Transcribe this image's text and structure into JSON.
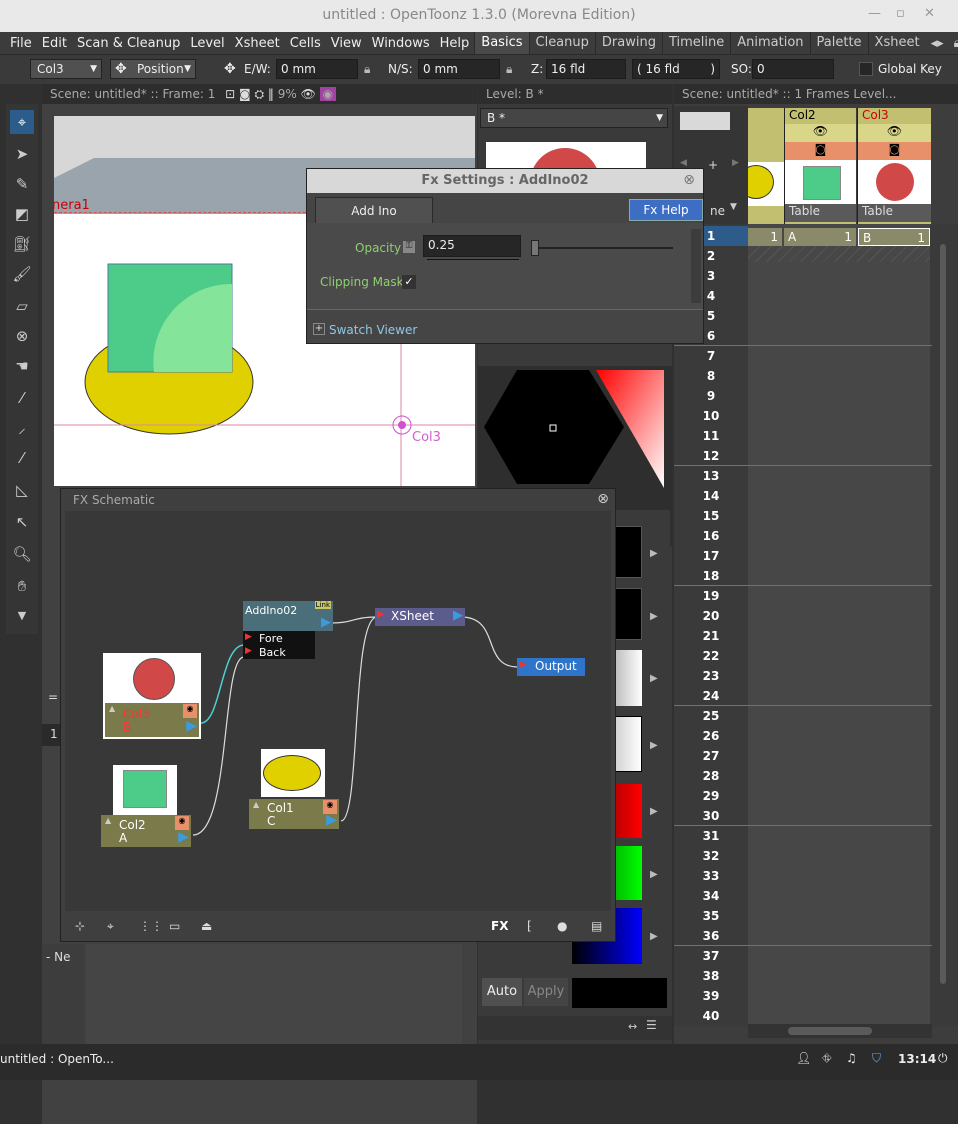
{
  "window": {
    "title": "untitled : OpenToonz 1.3.0 (Morevna Edition)",
    "min": "—",
    "max": "▫",
    "close": "✕"
  },
  "menu": [
    "File",
    "Edit",
    "Scan & Cleanup",
    "Level",
    "Xsheet",
    "Cells",
    "View",
    "Windows",
    "Help"
  ],
  "rooms": [
    "Basics",
    "Cleanup",
    "Drawing",
    "Timeline",
    "Animation",
    "Palette",
    "Xsheet"
  ],
  "tooloptions": {
    "object": "Col3",
    "mode": "Position",
    "ew_label": "E/W:",
    "ew_value": "0 mm",
    "ns_label": "N/S:",
    "ns_value": "0 mm",
    "z_label": "Z:",
    "z_value": "16 fld",
    "z_extra": "( 16 fld",
    "z_extra_close": ")",
    "so_label": "SO:",
    "so_value": "0",
    "global_key": "Global Key"
  },
  "viewer": {
    "header": "Scene: untitled*   ::   Frame: 1",
    "header_extra": "9%",
    "camera_label": "nera1",
    "col_label": "Col3"
  },
  "fxsettings": {
    "title": "Fx Settings : AddIno02",
    "tab": "Add Ino",
    "help": "Fx Help",
    "opacity_label": "Opacity",
    "opacity_value": "0.25",
    "clipping_label": "Clipping Mask",
    "swatch_viewer": "Swatch Viewer",
    "swatch_toggle": "+"
  },
  "level": {
    "header": "Level:  B *",
    "combo": "B *"
  },
  "schematic": {
    "title": "FX Schematic",
    "nodes": {
      "addino": {
        "name": "AddIno02",
        "link": "Link",
        "fore": "Fore",
        "back": "Back"
      },
      "xsheet": {
        "name": "XSheet"
      },
      "output": {
        "name": "Output"
      },
      "col3": {
        "name": "Col3",
        "level": "B"
      },
      "col2": {
        "name": "Col2",
        "level": "A"
      },
      "col1": {
        "name": "Col1",
        "level": "C"
      }
    },
    "footer_fx": "FX"
  },
  "xsheetpanel": {
    "header": "Scene: untitled*   ::   1 Frames  Level...",
    "columns": [
      {
        "name": "Col2",
        "pegbar": "Table",
        "cell": "A",
        "num": "1"
      },
      {
        "name": "Col3",
        "pegbar": "Table",
        "cell": "B",
        "num": "1"
      }
    ],
    "partial_pegbar": "ne",
    "first_num": "1",
    "rows": [
      "1",
      "2",
      "3",
      "4",
      "5",
      "6",
      "7",
      "8",
      "9",
      "10",
      "11",
      "12",
      "13",
      "14",
      "15",
      "16",
      "17",
      "18",
      "19",
      "20",
      "21",
      "22",
      "23",
      "24",
      "25",
      "26",
      "27",
      "28",
      "29",
      "30",
      "31",
      "32",
      "33",
      "34",
      "35",
      "36",
      "37",
      "38",
      "39",
      "40"
    ]
  },
  "style_editor": {
    "auto": "Auto",
    "apply": "Apply"
  },
  "side_labels": {
    "row1": "1",
    "neg": "- Ne"
  },
  "taskbar": {
    "app": "untitled : OpenTo...",
    "clock": "13:14"
  },
  "colors": {
    "accent_blue": "#3d7cd0",
    "node_col": "#7a7a4a",
    "node_fx": "#4a6e7a",
    "xsheet_node": "#5b5b8c",
    "output_node": "#2e74c9",
    "onion_red": "#e87070"
  }
}
